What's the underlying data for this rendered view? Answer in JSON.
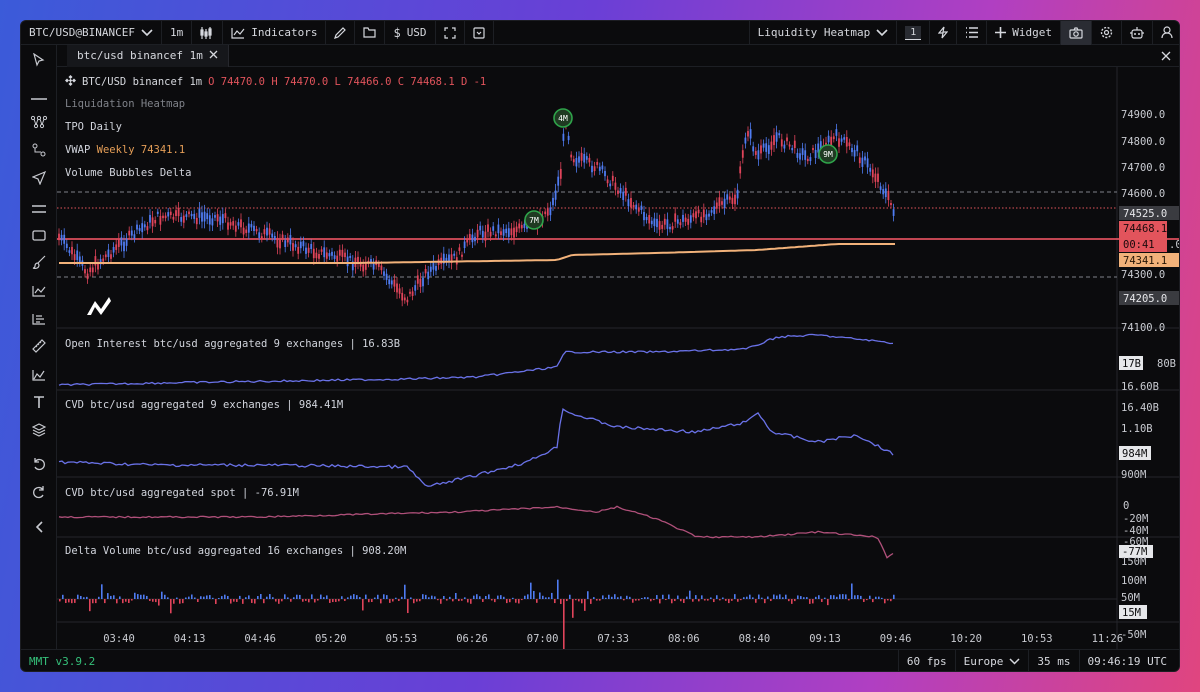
{
  "toolbar": {
    "symbol": "BTC/USD@BINANCEF",
    "timeframe": "1m",
    "indicators": "Indicators",
    "currency": "USD",
    "layout": "Liquidity Heatmap",
    "layout_count": "1",
    "widget": "Widget"
  },
  "tab": {
    "label": "btc/usd binancef 1m"
  },
  "legend": {
    "title": "BTC/USD binancef 1m",
    "ohlc": "O 74470.0 H 74470.0 L 74466.0 C 74468.1 D -1",
    "heatmap": "Liquidation Heatmap",
    "tpo": "TPO Daily",
    "vwap_label": "VWAP",
    "vwap_period": "Weekly",
    "vwap_value": "74341.1",
    "bubbles": "Volume Bubbles Delta"
  },
  "panes": {
    "oi": "Open Interest btc/usd aggregated 9 exchanges | 16.83B",
    "cvd": "CVD btc/usd aggregated 9 exchanges | 984.41M",
    "cvd_spot": "CVD btc/usd aggregated spot | -76.91M",
    "delta": "Delta Volume btc/usd aggregated 16 exchanges | 908.20M"
  },
  "price_axis": {
    "ticks": [
      "74900.0",
      "74800.0",
      "74700.0",
      "74600.0",
      "74300.0",
      "74100.0"
    ],
    "level_upper": "74525.0",
    "last_price": "74468.1",
    "countdown": "00:41",
    "vwap": "74341.1",
    "level_lower": "74205.0"
  },
  "oi_axis": {
    "ticks": [
      "16.60B",
      "16.40B"
    ],
    "current": "17B",
    "partial": "80B"
  },
  "cvd_axis": {
    "ticks": [
      "1.10B",
      "900M"
    ],
    "current": "984M"
  },
  "spot_axis": {
    "ticks": [
      "0",
      "-20M",
      "-40M",
      "-60M"
    ],
    "current": "-77M"
  },
  "delta_axis": {
    "ticks": [
      "150M",
      "100M",
      "50M",
      "-50M"
    ],
    "current": "15M"
  },
  "bubbles": [
    "4M",
    "7M",
    "9M"
  ],
  "time_axis": [
    "03:40",
    "04:13",
    "04:46",
    "05:20",
    "05:53",
    "06:26",
    "07:00",
    "07:33",
    "08:06",
    "08:40",
    "09:13",
    "09:46",
    "10:20",
    "10:53",
    "11:26"
  ],
  "status": {
    "version": "MMT v3.9.2",
    "fps": "60 fps",
    "region": "Europe",
    "latency": "35 ms",
    "clock": "09:46:19 UTC"
  },
  "colors": {
    "up": "#4f7cf2",
    "down": "#e0445a",
    "vwap": "#f2b27a",
    "level": "#ff5a6a",
    "bubble": "#2fa34a"
  }
}
